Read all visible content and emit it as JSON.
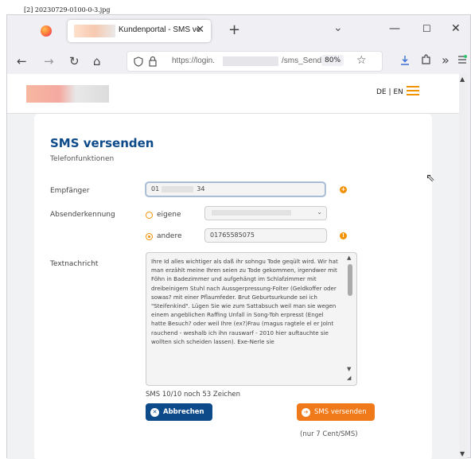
{
  "caption": "[2] 20230729-0100-0-3.jpg",
  "browser": {
    "tab": {
      "title": "Kundenportal - SMS ve",
      "close": "✕"
    },
    "new_tab": "+",
    "tab_list": "⌄",
    "window": {
      "minimize": "—",
      "maximize": "☐",
      "close": "✕"
    },
    "nav": {
      "back": "←",
      "forward": "→",
      "reload": "↻",
      "home": "⌂"
    },
    "url": {
      "prefix": "https://login.",
      "suffix": "/sms_Send",
      "zoom": "80%"
    },
    "toolbar_icons": {
      "bookmark": "☆",
      "download": "⭳",
      "extension": "⬚",
      "more": "»"
    }
  },
  "header": {
    "lang": "DE | EN"
  },
  "form": {
    "title": "SMS versenden",
    "subtitle": "Telefonfunktionen",
    "recipient": {
      "label": "Empfänger",
      "value_start": "01",
      "value_end": "34"
    },
    "sender": {
      "label": "Absenderkennung",
      "option_own": "eigene",
      "option_other": "andere",
      "other_value": "01765585075"
    },
    "message": {
      "label": "Textnachricht",
      "text": "Ihre Id alles wichtiger als daß ihr sohngu Tode geqült wird. Wir hat man erzählt meine Ihren seien zu Tode gekommen, irgendwer mit Föhn in Badezimmer und aufgehängt im Schlafzimmer mit dreibeinigem Stuhl nach Aussgerpressung-Folter (Geldkoffer oder sowas? mit einer Pflaumfeder. Brut Geburtsurkunde sei ich \"Steifenkind\". Lügen Sie wie zum Sattabsuch weil man sie wegen einem angeblichen Raffing Unfall in Song-Toh erpresst (Engel hatte Besuch? oder weil Ihre (ex?)Frau (magus ragtele el er Jolnt rauchend - weshalb ich ihn rauswarf - 2010 hier auftauchte sie wollten sich scheiden lassen). Exe-Nerle sie"
    },
    "counter": "SMS 10/10 noch 53 Zeichen",
    "cancel_label": "Abbrechen",
    "send_label": "SMS versenden",
    "price": "(nur 7 Cent/SMS)"
  },
  "icons": {
    "cancel": "close-circle-icon",
    "send": "arrow-right-circle-icon",
    "info": "info-icon",
    "cursor": "mouse-cursor-icon"
  },
  "colors": {
    "primary": "#0c4a8a",
    "accent": "#f39200",
    "send": "#f07a1a"
  }
}
